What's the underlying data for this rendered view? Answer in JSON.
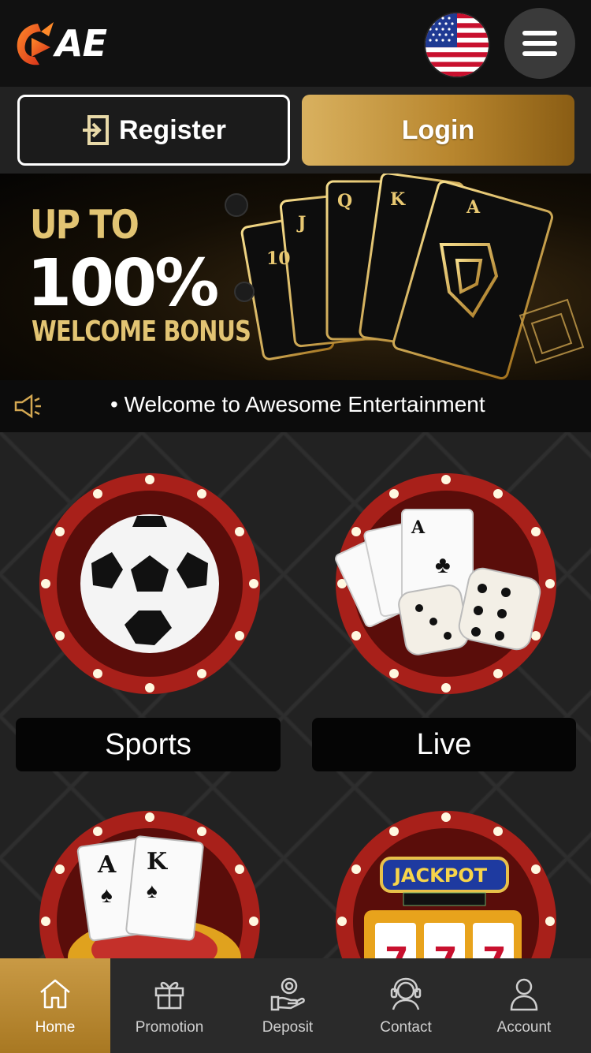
{
  "header": {
    "logo_text": "AE",
    "language_flag": "us-flag-icon",
    "menu_icon": "hamburger-menu-icon"
  },
  "auth": {
    "register_label": "Register",
    "login_label": "Login"
  },
  "banner": {
    "line1": "UP TO",
    "line2": "100%",
    "line3": "WELCOME BONUS"
  },
  "announcement": {
    "text": "• Welcome to Awesome Entertainment"
  },
  "games": [
    {
      "label": "Sports",
      "icon": "soccer-ball-icon"
    },
    {
      "label": "Live",
      "icon": "cards-dice-icon"
    },
    {
      "label": "",
      "icon": "poker-cards-icon"
    },
    {
      "label": "",
      "icon": "jackpot-slot-icon"
    }
  ],
  "nav": [
    {
      "label": "Home",
      "icon": "home-icon",
      "active": true
    },
    {
      "label": "Promotion",
      "icon": "gift-icon",
      "active": false
    },
    {
      "label": "Deposit",
      "icon": "deposit-icon",
      "active": false
    },
    {
      "label": "Contact",
      "icon": "headset-icon",
      "active": false
    },
    {
      "label": "Account",
      "icon": "user-icon",
      "active": false
    }
  ],
  "colors": {
    "gold": "#c99a45",
    "background": "#222222",
    "header": "#111111"
  }
}
